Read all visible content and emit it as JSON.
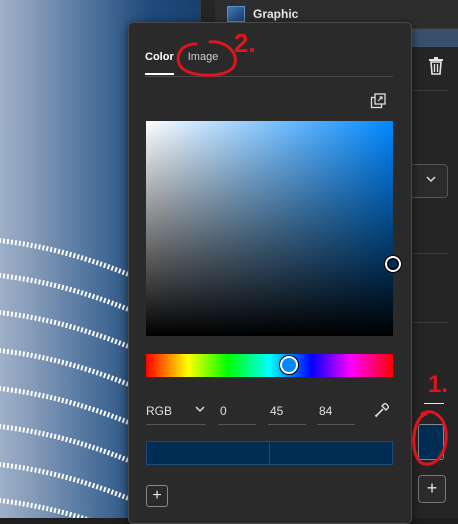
{
  "layer": {
    "name": "Graphic",
    "thumb_icon": "graphic-layer-icon"
  },
  "picker": {
    "tabs": [
      {
        "label": "Color"
      },
      {
        "label": "Image"
      }
    ],
    "active_tab": "Color",
    "mode": "RGB",
    "channels": {
      "r": "0",
      "g": "45",
      "b": "84"
    },
    "current_color": "#002d54",
    "add_label": "+"
  },
  "right_panel": {
    "add_label": "+",
    "degree_symbol": "°"
  },
  "annotations": {
    "one": "1.",
    "two": "2."
  },
  "colors": {
    "accent_annotation": "#e0141c",
    "swatch": "#002d54"
  },
  "icons": [
    "trash-icon",
    "swap-icon",
    "chevron-down-icon",
    "eyedropper-icon",
    "plus-icon"
  ]
}
